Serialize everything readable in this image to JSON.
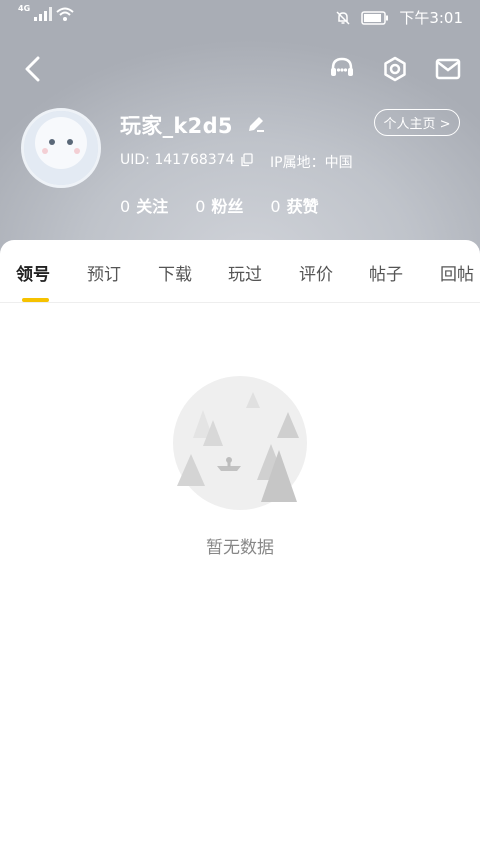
{
  "status_bar": {
    "network": "4G",
    "time": "下午3:01"
  },
  "header": {
    "username": "玩家_k2d5",
    "profile_button": "个人主页 >",
    "uid": "UID: 141768374",
    "ip_location": "IP属地：中国",
    "stats": [
      {
        "count": "0",
        "label": "关注"
      },
      {
        "count": "0",
        "label": "粉丝"
      },
      {
        "count": "0",
        "label": "获赞"
      }
    ]
  },
  "tabs": [
    {
      "label": "领号",
      "active": true
    },
    {
      "label": "预订",
      "active": false
    },
    {
      "label": "下载",
      "active": false
    },
    {
      "label": "玩过",
      "active": false
    },
    {
      "label": "评价",
      "active": false
    },
    {
      "label": "帖子",
      "active": false
    },
    {
      "label": "回帖",
      "active": false
    }
  ],
  "empty_state": {
    "text": "暂无数据"
  },
  "colors": {
    "accent": "#f6c200",
    "header_bg": "#bfc3ca"
  },
  "icons": [
    "back-arrow-icon",
    "customer-service-icon",
    "settings-icon",
    "mail-icon",
    "edit-icon",
    "copy-icon"
  ]
}
